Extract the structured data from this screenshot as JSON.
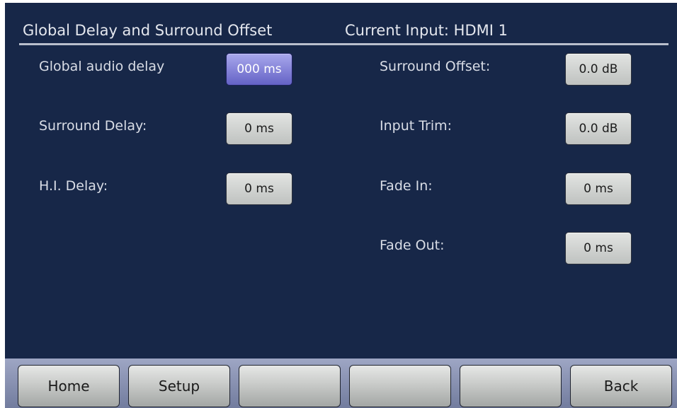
{
  "header": {
    "title": "Global Delay and Surround Offset",
    "current_input": "Current Input: HDMI 1"
  },
  "left_settings": [
    {
      "label": "Global audio delay",
      "value": "000 ms",
      "selected": true
    },
    {
      "label": "Surround Delay:",
      "value": "0 ms",
      "selected": false
    },
    {
      "label": "H.I. Delay:",
      "value": "0 ms",
      "selected": false
    }
  ],
  "right_settings": [
    {
      "label": "Surround Offset:",
      "value": "0.0 dB"
    },
    {
      "label": "Input Trim:",
      "value": "0.0 dB"
    },
    {
      "label": "Fade In:",
      "value": "0 ms"
    },
    {
      "label": "Fade Out:",
      "value": "0 ms"
    }
  ],
  "footer": {
    "buttons": [
      "Home",
      "Setup",
      "",
      "",
      "",
      "Back"
    ]
  },
  "colors": {
    "background": "#172748",
    "selected_value": "#6f6dd0",
    "footer": "#8891b3"
  }
}
